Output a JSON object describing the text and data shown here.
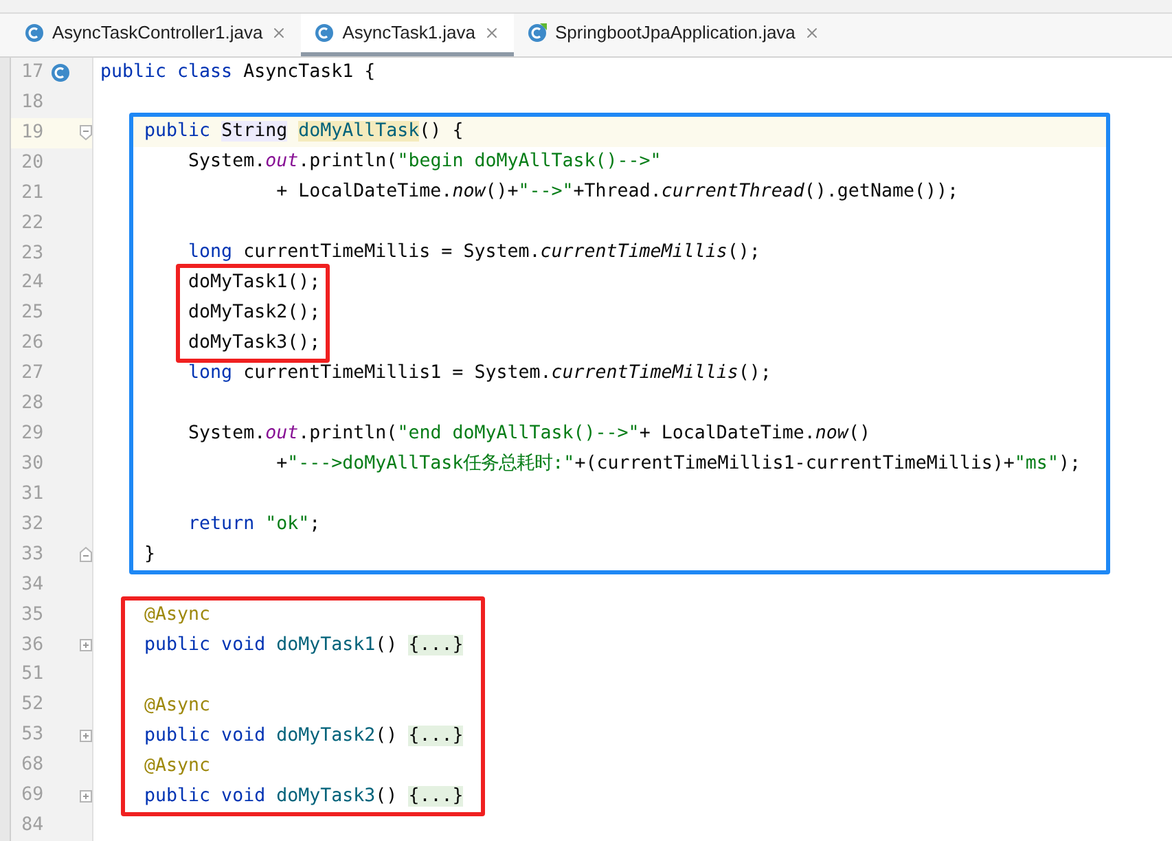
{
  "tabs": [
    {
      "label": "AsyncTaskController1.java",
      "kind": "class",
      "selected": false
    },
    {
      "label": "AsyncTask1.java",
      "kind": "class",
      "selected": true
    },
    {
      "label": "SpringbootJpaApplication.java",
      "kind": "spring",
      "selected": false
    }
  ],
  "code": [
    {
      "kind": "class_decl",
      "number": "17",
      "tokens": [
        {
          "kind": "kw",
          "text": "public class "
        },
        {
          "kind": "plain",
          "text": "AsyncTask1 {"
        }
      ]
    },
    {
      "kind": "line",
      "number": "18"
    },
    {
      "kind": "method_box",
      "color": "#1e88f5",
      "children": [
        {
          "kind": "block_start",
          "number": "19",
          "current": true,
          "tokens": [
            {
              "kind": "kw",
              "text": "    public "
            },
            {
              "kind": "type_hl",
              "text": "String"
            },
            {
              "kind": "method_hl",
              "text": "doMyAllTask"
            },
            {
              "kind": "plain",
              "text": "() {"
            }
          ]
        },
        {
          "kind": "line",
          "number": "20",
          "tokens": [
            {
              "kind": "plain",
              "text": "        System."
            },
            {
              "kind": "field",
              "text": "out"
            },
            {
              "kind": "plain",
              "text": ".println("
            },
            {
              "kind": "str",
              "text": "\"begin doMyAllTask()-->\""
            }
          ]
        },
        {
          "kind": "line",
          "number": "21",
          "tokens": [
            {
              "kind": "plain",
              "text": "                + LocalDateTime."
            },
            {
              "kind": "static",
              "text": "now"
            },
            {
              "kind": "plain",
              "text": "()+"
            },
            {
              "kind": "str",
              "text": "\"-->\""
            },
            {
              "kind": "plain",
              "text": "+Thread."
            },
            {
              "kind": "static",
              "text": "currentThread"
            },
            {
              "kind": "plain",
              "text": "().getName());"
            }
          ]
        },
        {
          "kind": "line",
          "number": "22"
        },
        {
          "kind": "line",
          "number": "23",
          "tokens": [
            {
              "kind": "kw",
              "text": "        long"
            },
            {
              "kind": "plain",
              "text": " currentTimeMillis = System."
            },
            {
              "kind": "static",
              "text": "currentTimeMillis"
            },
            {
              "kind": "plain",
              "text": "();"
            }
          ]
        },
        {
          "kind": "call_box",
          "color": "#f02020",
          "children": [
            {
              "kind": "line",
              "number": "24",
              "tokens": [
                {
                  "kind": "plain",
                  "text": "        doMyTask1();"
                }
              ]
            },
            {
              "kind": "line",
              "number": "25",
              "tokens": [
                {
                  "kind": "plain",
                  "text": "        doMyTask2();"
                }
              ]
            },
            {
              "kind": "line",
              "number": "26",
              "tokens": [
                {
                  "kind": "plain",
                  "text": "        doMyTask3();"
                }
              ]
            }
          ]
        },
        {
          "kind": "line",
          "number": "27",
          "tokens": [
            {
              "kind": "kw",
              "text": "        long"
            },
            {
              "kind": "plain",
              "text": " currentTimeMillis1 = System."
            },
            {
              "kind": "static",
              "text": "currentTimeMillis"
            },
            {
              "kind": "plain",
              "text": "();"
            }
          ]
        },
        {
          "kind": "line",
          "number": "28"
        },
        {
          "kind": "line",
          "number": "29",
          "tokens": [
            {
              "kind": "plain",
              "text": "        System."
            },
            {
              "kind": "field",
              "text": "out"
            },
            {
              "kind": "plain",
              "text": ".println("
            },
            {
              "kind": "str",
              "text": "\"end doMyAllTask()-->\""
            },
            {
              "kind": "plain",
              "text": "+ LocalDateTime."
            },
            {
              "kind": "static",
              "text": "now"
            },
            {
              "kind": "plain",
              "text": "()"
            }
          ]
        },
        {
          "kind": "line",
          "number": "30",
          "tokens": [
            {
              "kind": "plain",
              "text": "                +"
            },
            {
              "kind": "str",
              "text": "\"--->doMyAllTask任务总耗时:\""
            },
            {
              "kind": "plain",
              "text": "+(currentTimeMillis1-currentTimeMillis)+"
            },
            {
              "kind": "str",
              "text": "\"ms\""
            },
            {
              "kind": "plain",
              "text": ");"
            }
          ]
        },
        {
          "kind": "line",
          "number": "31"
        },
        {
          "kind": "line",
          "number": "32",
          "tokens": [
            {
              "kind": "kw",
              "text": "        return "
            },
            {
              "kind": "str",
              "text": "\"ok\""
            },
            {
              "kind": "plain",
              "text": ";"
            }
          ]
        },
        {
          "kind": "block_end",
          "number": "33",
          "tokens": [
            {
              "kind": "plain",
              "text": "    }"
            }
          ]
        }
      ]
    },
    {
      "kind": "line",
      "number": "34"
    },
    {
      "kind": "async_box",
      "color": "#f02020",
      "children": [
        {
          "kind": "line",
          "number": "35",
          "tokens": [
            {
              "kind": "annot",
              "text": "    @Async"
            }
          ]
        },
        {
          "kind": "collapsible",
          "number": "36",
          "expanded": false,
          "tokens": [
            {
              "kind": "kw",
              "text": "    public void "
            },
            {
              "kind": "method",
              "text": "doMyTask1"
            },
            {
              "kind": "plain",
              "text": "() "
            },
            {
              "kind": "folded",
              "text": "{...}"
            }
          ]
        },
        {
          "kind": "line",
          "number": "51"
        },
        {
          "kind": "line",
          "number": "52",
          "tokens": [
            {
              "kind": "annot",
              "text": "    @Async"
            }
          ]
        },
        {
          "kind": "collapsible",
          "number": "53",
          "expanded": false,
          "tokens": [
            {
              "kind": "kw",
              "text": "    public void "
            },
            {
              "kind": "method",
              "text": "doMyTask2"
            },
            {
              "kind": "plain",
              "text": "() "
            },
            {
              "kind": "folded",
              "text": "{...}"
            }
          ]
        },
        {
          "kind": "line",
          "number": "68",
          "tokens": [
            {
              "kind": "annot",
              "text": "    @Async"
            }
          ]
        },
        {
          "kind": "collapsible",
          "number": "69",
          "expanded": false,
          "tokens": [
            {
              "kind": "kw",
              "text": "    public void "
            },
            {
              "kind": "method",
              "text": "doMyTask3"
            },
            {
              "kind": "plain",
              "text": "() "
            },
            {
              "kind": "folded",
              "text": "{...}"
            }
          ]
        }
      ]
    },
    {
      "kind": "line",
      "number": "84"
    }
  ]
}
